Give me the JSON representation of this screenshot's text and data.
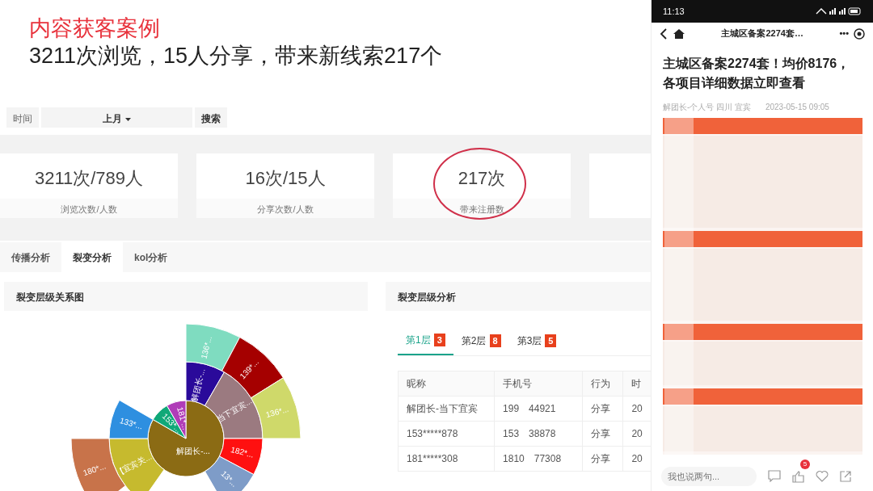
{
  "slide": {
    "title": "内容获客案例",
    "subtitle": "3211次浏览，15人分享，带来新线索217个"
  },
  "dashboard": {
    "filter": {
      "label": "时间",
      "value": "上月",
      "button": "搜索"
    },
    "stats": [
      {
        "value": "3211次/789人",
        "label": "浏览次数/人数",
        "highlighted": false
      },
      {
        "value": "16次/15人",
        "label": "分享次数/人数",
        "highlighted": false
      },
      {
        "value": "217次",
        "label": "带来注册数",
        "highlighted": true
      }
    ],
    "tabs": [
      {
        "label": "传播分析",
        "selected": false
      },
      {
        "label": "裂变分析",
        "selected": true
      },
      {
        "label": "kol分析",
        "selected": false
      }
    ],
    "relation_panel": {
      "title": "裂变层级关系图",
      "nodes": [
        {
          "label": "解团长-...",
          "color": "#8b6b14",
          "children": [
            {
              "label": "解团长-...",
              "color": "#2a0a9a",
              "children": [
                {
                  "label": "136*...",
                  "color": "#7fdcc0"
                }
              ]
            },
            {
              "label": "当下宜宾...",
              "color": "#9b7a80",
              "children": [
                {
                  "label": "139*...",
                  "color": "#a50000"
                },
                {
                  "label": "136*...",
                  "color": "#cfd96a"
                }
              ]
            },
            {
              "label": "182*...",
              "color": "#ff1010"
            },
            {
              "label": "13*...",
              "color": "#7e9cc8"
            },
            {
              "label": "【宜宾关...",
              "color": "#c6ba2e",
              "children": [
                {
                  "label": "180*...",
                  "color": "#c8734a"
                }
              ]
            },
            {
              "label": "133*...",
              "color": "#2e8fe0"
            }
          ]
        },
        {
          "label": "153*...",
          "color": "#10a878"
        },
        {
          "label": "181*...",
          "color": "#b03cb8"
        }
      ]
    },
    "level_panel": {
      "title": "裂变层级分析",
      "level_tabs": [
        {
          "label": "第1层",
          "count": "3",
          "selected": true
        },
        {
          "label": "第2层",
          "count": "8",
          "selected": false
        },
        {
          "label": "第3层",
          "count": "5",
          "selected": false
        }
      ],
      "columns": [
        "昵称",
        "手机号",
        "行为",
        "时"
      ],
      "rows": [
        {
          "nickname": "解团长-当下宜宾",
          "phone": [
            "199",
            "44921"
          ],
          "action": "分享",
          "time": "20"
        },
        {
          "nickname": "153*****878",
          "phone": [
            "153",
            "38878"
          ],
          "action": "分享",
          "time": "20"
        },
        {
          "nickname": "181*****308",
          "phone": [
            "1810",
            "77308"
          ],
          "action": "分享",
          "time": "20"
        }
      ]
    }
  },
  "phone": {
    "time": "11:13",
    "nav_title": "主城区备案2274套…",
    "nav_more": "•••",
    "article_title": "主城区备案2274套！均价8176，各项目详细数据立即查看",
    "author": "解团长-个人号 四川 宜宾",
    "date": "2023-05-15 09:05",
    "comment_placeholder": "我也说两句...",
    "like_count": "5"
  }
}
